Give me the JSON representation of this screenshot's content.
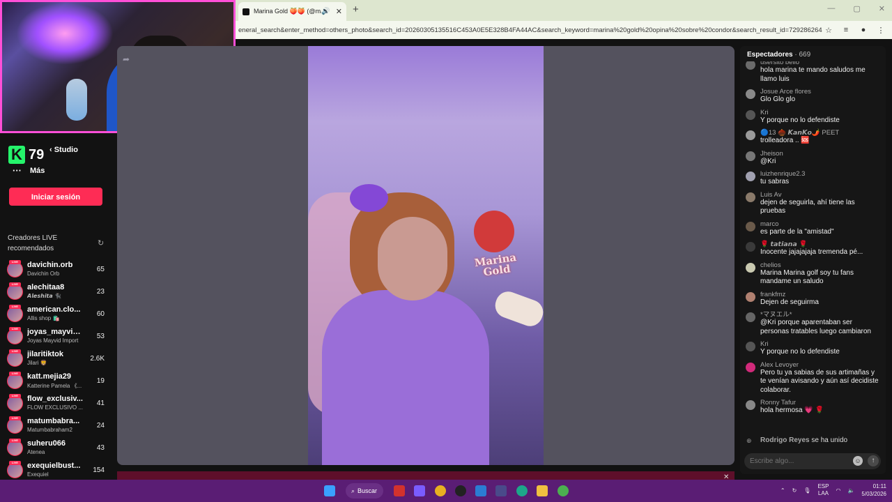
{
  "browser": {
    "tab_title": "Marina Gold 🍑🍑 (@marina",
    "url": "eneral_search&enter_method=others_photo&search_id=20260305135516C453A0E5E328B4FA44AC&search_keyword=marina%20gold%20opina%20sobre%20condor&search_result_id=729286264665...",
    "icons": [
      "tiktok-icon",
      "speaker-icon",
      "close-icon",
      "plus-icon",
      "minimize-icon",
      "maximize-icon",
      "close-window-icon",
      "star-icon",
      "media-icon",
      "profile-icon",
      "kebab-menu-icon"
    ]
  },
  "sidebar": {
    "viewer_number": "79",
    "studio_label": "‹ Studio",
    "more_label": "Más",
    "more_dots": "···",
    "login_label": "Iniciar sesión",
    "creators_heading": "Creadores LIVE recomendados",
    "creators": [
      {
        "name": "davichin.orb",
        "sub": "Davichin Orb",
        "count": "65"
      },
      {
        "name": "alechitaa8",
        "sub": "𝘼𝙡𝙚𝙨𝙝𝙞𝙩𝙖 🐈‍⬛",
        "count": "23"
      },
      {
        "name": "american.clo...",
        "sub": "Allis shop 🛍️",
        "count": "60"
      },
      {
        "name": "joyas_mayvid...",
        "sub": "Joyas Mayvid Import",
        "count": "53"
      },
      {
        "name": "jilaritiktok",
        "sub": "Jilari 🦁",
        "count": "2.6K"
      },
      {
        "name": "katt.mejia29",
        "sub": "Katterine Pamela 《...",
        "count": "19"
      },
      {
        "name": "flow_exclusiv...",
        "sub": "FLOW EXCLUSIVO ...",
        "count": "41"
      },
      {
        "name": "matumbabra...",
        "sub": "Matumbabraham2",
        "count": "24"
      },
      {
        "name": "suheru066",
        "sub": "Atenea",
        "count": "43"
      },
      {
        "name": "exequielbust...",
        "sub": "Exequiel",
        "count": "154"
      }
    ],
    "live_badge": "LIVE"
  },
  "video": {
    "logo_text": "Marina Gold"
  },
  "chat": {
    "title": "Espectadores",
    "viewer_count": "· 669",
    "messages": [
      {
        "user": "usersito bello",
        "text": "hola marina te mando saludos me llamo luis",
        "avatar": "#6b6b6b"
      },
      {
        "user": "Josue Arce flores",
        "text": "Glo Glo glo",
        "avatar": "#8a8a8a"
      },
      {
        "user": "Kri",
        "text": "Y porque no lo defendiste",
        "avatar": "#555"
      },
      {
        "user": "🔵13 🌰 𝙆𝙖𝙣𝙆𝙤🌶️ PEET",
        "text": "trolleadora .. 🆘",
        "avatar": "#9a9a9a"
      },
      {
        "user": "Jheison",
        "text": "@Kri",
        "avatar": "#777"
      },
      {
        "user": "luizhenrique2.3",
        "text": "tu sabras",
        "avatar": "#a0a0b0"
      },
      {
        "user": "Luis Av",
        "text": "dejen de seguirla, ahí tiene las pruebas",
        "avatar": "#8a7a6a"
      },
      {
        "user": "marco",
        "text": "es parte de la \"amistad\"",
        "avatar": "#6a5a4a"
      },
      {
        "user": "🌹 𝙩𝙖𝙩𝙞𝙖𝙣𝙖 🌹",
        "text": "Inocente jajajajaja tremenda pé...",
        "avatar": "#3a3a3a"
      },
      {
        "user": "chelios",
        "text": "Marina Marina golf soy tu fans mandame un saludo",
        "avatar": "#c9c9b0"
      },
      {
        "user": "frankfmz",
        "text": "Dejen de seguirma",
        "avatar": "#b08070"
      },
      {
        "user": "*マヌエル*",
        "text": "@Kri porque aparentaban ser personas tratables luego cambiaron",
        "avatar": "#666"
      },
      {
        "user": "Kri",
        "text": "Y porque no lo defendiste",
        "avatar": "#555"
      },
      {
        "user": "Alex Levoyer",
        "text": "Pero tu ya sabias de sus artimañas y te venían avisando y aún así decidiste colaborar.",
        "avatar": "#d12a7a"
      },
      {
        "user": "Ronny Tafur",
        "text": "hola hermosa 💗 🌹",
        "avatar": "#888"
      }
    ],
    "join_user": "Rodrigo Reyes",
    "join_text": "se ha unido",
    "input_placeholder": "Escribe algo..."
  },
  "taskbar": {
    "search_label": "Buscar",
    "lang_1": "ESP",
    "lang_2": "LAA",
    "time": "01:11",
    "date": "5/03/2026"
  }
}
